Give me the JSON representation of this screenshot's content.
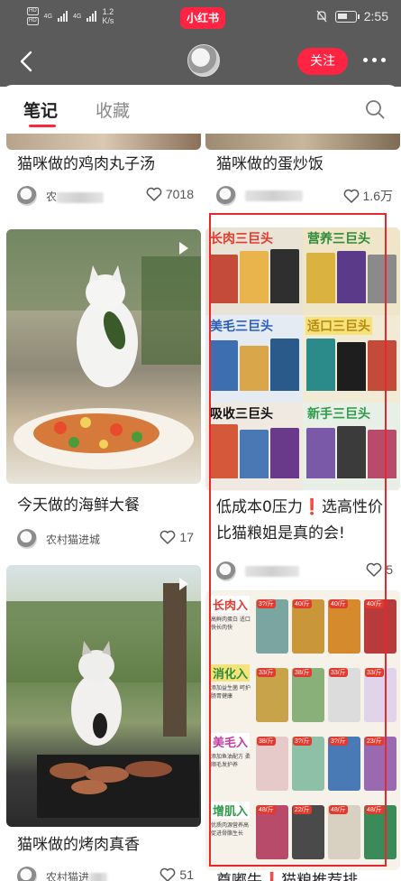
{
  "status_bar": {
    "hd1": "HD",
    "hd2": "HD",
    "net1": "4G",
    "net2": "4G",
    "speed_value": "1.2",
    "speed_unit": "K/s",
    "app_badge": "小红书",
    "time": "2:55",
    "battery_level": 0.55
  },
  "nav": {
    "follow_label": "关注"
  },
  "tabs": {
    "notes": "笔记",
    "favorites": "收藏"
  },
  "left_column": [
    {
      "title": "猫咪做的鸡肉丸子汤",
      "author_prefix": "农",
      "likes": "7018"
    },
    {
      "title": "今天做的海鲜大餐",
      "author": "农村猫进城",
      "likes": "17"
    },
    {
      "title": "猫咪做的烤肉真香",
      "author": "农村猫进",
      "likes": "51"
    }
  ],
  "right_column": [
    {
      "title": "猫咪做的蛋炒饭",
      "likes": "1.6万"
    },
    {
      "title": "低成本0压力❗选高性价比猫粮姐是真的会!",
      "likes": "5",
      "labels": [
        "长肉三巨头",
        "营养三巨头",
        "美毛三巨头",
        "适口三巨头",
        "吸收三巨头",
        "新手三巨头"
      ]
    },
    {
      "title": "尊嘟牛❗猫粮推荐排",
      "rows": [
        {
          "label": "长肉入",
          "desc": "高鲜肉蛋白 适口快长肉快",
          "prices": [
            "3?/斤",
            "40/斤",
            "40/斤",
            "40/斤"
          ]
        },
        {
          "label": "消化入",
          "desc": "添加益生菌 呵护肠胃健康",
          "prices": [
            "33/斤",
            "38/斤",
            "33/斤",
            "33/斤"
          ]
        },
        {
          "label": "美毛入",
          "desc": "添加鱼油配方 柔顺毛发护养",
          "prices": [
            "38/斤",
            "3?/斤",
            "3?/斤",
            "23/斤"
          ]
        },
        {
          "label": "增肌入",
          "desc": "优质肉源营养高 促进骨骼生长",
          "prices": [
            "48/斤",
            "22/斤",
            "48/斤",
            "48/斤"
          ]
        }
      ]
    }
  ],
  "colors": {
    "brand": "#ff2442",
    "header_bg": "#5b5b5b",
    "highlight": "#e8262d"
  }
}
